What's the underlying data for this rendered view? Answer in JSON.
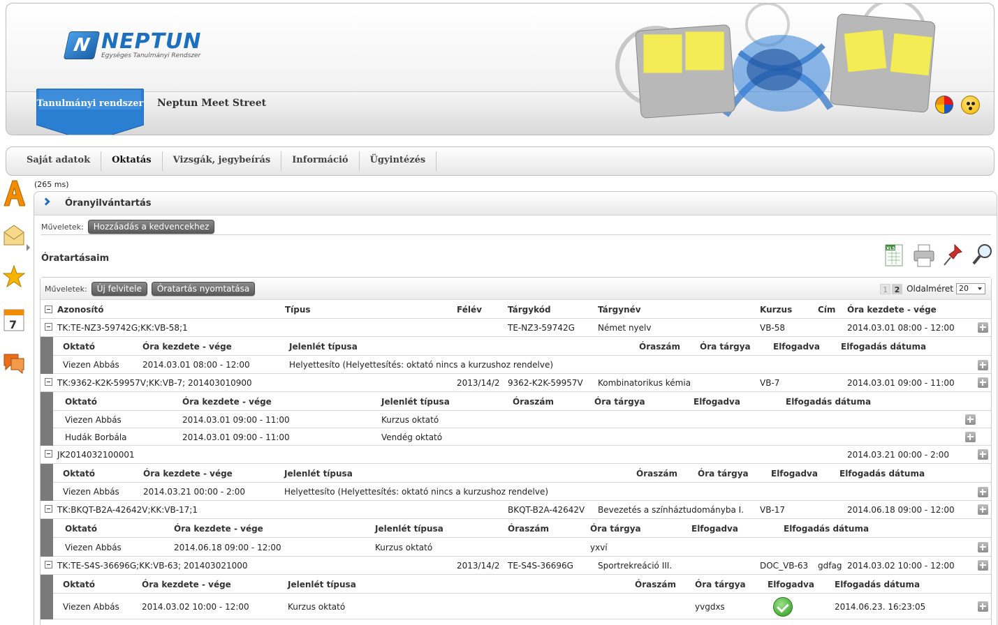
{
  "header": {
    "logo_title": "NEPTUN",
    "logo_subtitle": "Egységes Tanulmányi Rendszer",
    "system_tab": "Tanulmányi rendszer",
    "meet_street": "Neptun Meet Street"
  },
  "menu": [
    "Saját adatok",
    "Oktatás",
    "Vizsgák, jegybeírás",
    "Információ",
    "Ügyintézés"
  ],
  "timing": "(265 ms)",
  "panel": {
    "title": "Óranyilvántartás",
    "ops_label": "Műveletek:",
    "fav_button": "Hozzáadás a kedvencekhez",
    "section_title": "Óratartásaim"
  },
  "grid": {
    "ops_label": "Műveletek:",
    "new_button": "Új felvitele",
    "print_button": "Óratartás nyomtatása",
    "pages": [
      "1",
      "2"
    ],
    "page_size_label": "Oldalméret",
    "page_size": "20",
    "columns": {
      "id": "Azonosító",
      "type": "Típus",
      "term": "Félév",
      "code": "Tárgykód",
      "name": "Tárgynév",
      "course": "Kurzus",
      "addr": "Cím",
      "time": "Óra kezdete - vége"
    },
    "sub_columns": {
      "teacher": "Oktató",
      "time": "Óra kezdete - vége",
      "attend": "Jelenlét típusa",
      "hours": "Óraszám",
      "topic": "Óra tárgya",
      "accepted": "Elfogadva",
      "accept_date": "Elfogadás dátuma"
    },
    "rows": [
      {
        "id": "TK:TE-NZ3-59742G;KK:VB-58;1",
        "term": "",
        "code": "TE-NZ3-59742G",
        "name": "Német nyelv",
        "course": "VB-58",
        "addr": "",
        "time": "2014.03.01 08:00 - 12:00",
        "details": [
          {
            "teacher": "Viezen Abbás",
            "time": "2014.03.01 08:00 - 12:00",
            "attend": "Helyettesíto (Helyettesítés: oktató nincs a kurzushoz rendelve)",
            "hours": "",
            "topic": "",
            "accept_date": ""
          }
        ]
      },
      {
        "id": "TK:9362-K2K-59957V;KK:VB-7; 201403010900",
        "term": "2013/14/2",
        "code": "9362-K2K-59957V",
        "name": "Kombinatorikus kémia",
        "course": "VB-7",
        "addr": "",
        "time": "2014.03.01 09:00 - 11:00",
        "details": [
          {
            "teacher": "Viezen Abbás",
            "time": "2014.03.01 09:00 - 11:00",
            "attend": "Kurzus oktató",
            "hours": "",
            "topic": "",
            "accept_date": ""
          },
          {
            "teacher": "Hudák Borbála",
            "time": "2014.03.01 09:00 - 11:00",
            "attend": "Vendég oktató",
            "hours": "",
            "topic": "",
            "accept_date": ""
          }
        ]
      },
      {
        "id": "JK2014032100001",
        "term": "",
        "code": "",
        "name": "",
        "course": "",
        "addr": "",
        "time": "2014.03.21 00:00 - 2:00",
        "details": [
          {
            "teacher": "Viezen Abbás",
            "time": "2014.03.21 00:00 - 2:00",
            "attend": "Helyettesíto (Helyettesítés: oktató nincs a kurzushoz rendelve)",
            "hours": "",
            "topic": "",
            "accept_date": ""
          }
        ]
      },
      {
        "id": "TK:BKQT-B2A-42642V;KK:VB-17;1",
        "term": "",
        "code": "BKQT-B2A-42642V",
        "name": "Bevezetés a színháztudományba I.",
        "course": "VB-17",
        "addr": "",
        "time": "2014.06.18 09:00 - 12:00",
        "details": [
          {
            "teacher": "Viezen Abbás",
            "time": "2014.06.18 09:00 - 12:00",
            "attend": "Kurzus oktató",
            "hours": "",
            "topic": "yxví",
            "accept_date": ""
          }
        ]
      },
      {
        "id": "TK:TE-S4S-36696G;KK:VB-63; 201403021000",
        "term": "2013/14/2",
        "code": "TE-S4S-36696G",
        "name": "Sportrekreáció III.",
        "course": "DOC_VB-63",
        "addr": "gdfag",
        "time": "2014.03.02 10:00 - 12:00",
        "details": [
          {
            "teacher": "Viezen Abbás",
            "time": "2014.03.02 10:00 - 12:00",
            "attend": "Kurzus oktató",
            "hours": "",
            "topic": "yvgdxs",
            "accepted": true,
            "accept_date": "2014.06.23. 16:23:05"
          }
        ]
      }
    ]
  },
  "colors": {
    "brand_blue": "#1d6fc0",
    "tab_blue": "#2a7fd2",
    "button_dark": "#5a5a5a",
    "accept_green": "#2b9a1c"
  }
}
